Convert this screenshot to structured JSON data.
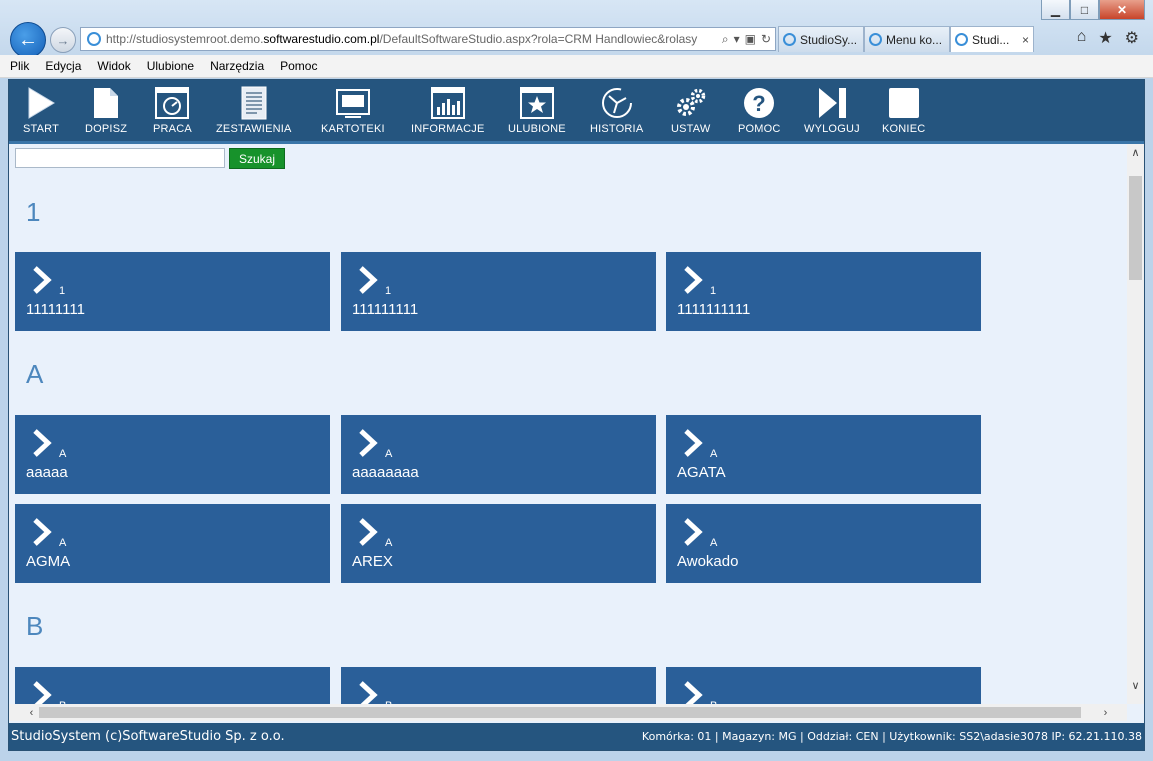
{
  "browser": {
    "url_pre": "http://studiosystemroot.demo.",
    "url_domain": "softwarestudio.com.pl",
    "url_post": "/DefaultSoftwareStudio.aspx?rola=CRM Handlowiec&rolasy",
    "tabs": [
      {
        "label": "StudioSy..."
      },
      {
        "label": "Menu ko..."
      },
      {
        "label": "Studi...",
        "close": "×"
      }
    ],
    "win_buttons": {
      "minimize": "▁",
      "maximize": "□",
      "close": "✕"
    }
  },
  "menu": [
    "Plik",
    "Edycja",
    "Widok",
    "Ulubione",
    "Narzędzia",
    "Pomoc"
  ],
  "toolbar": {
    "items": [
      {
        "label": "START",
        "icon": "play-icon"
      },
      {
        "label": "DOPISZ",
        "icon": "document-icon"
      },
      {
        "label": "PRACA",
        "icon": "gauge-window-icon"
      },
      {
        "label": "ZESTAWIENIA",
        "icon": "report-icon"
      },
      {
        "label": "KARTOTEKI",
        "icon": "monitor-icon"
      },
      {
        "label": "INFORMACJE",
        "icon": "bar-chart-icon"
      },
      {
        "label": "ULUBIONE",
        "icon": "star-window-icon"
      },
      {
        "label": "HISTORIA",
        "icon": "history-icon"
      },
      {
        "label": "USTAW",
        "icon": "gears-icon"
      },
      {
        "label": "POMOC",
        "icon": "help-icon"
      },
      {
        "label": "WYLOGUJ",
        "icon": "skip-icon"
      },
      {
        "label": "KONIEC",
        "icon": "square-icon"
      }
    ]
  },
  "search": {
    "button": "Szukaj",
    "value": ""
  },
  "groups": [
    {
      "head": "1",
      "tiles": [
        {
          "letter": "1",
          "name": "11111111"
        },
        {
          "letter": "1",
          "name": "111111111"
        },
        {
          "letter": "1",
          "name": "1111111111"
        }
      ]
    },
    {
      "head": "A",
      "tiles": [
        {
          "letter": "A",
          "name": "aaaaa"
        },
        {
          "letter": "A",
          "name": "aaaaaaaa"
        },
        {
          "letter": "A",
          "name": "AGATA"
        },
        {
          "letter": "A",
          "name": "AGMA"
        },
        {
          "letter": "A",
          "name": "AREX"
        },
        {
          "letter": "A",
          "name": "Awokado"
        }
      ]
    },
    {
      "head": "B",
      "tiles": [
        {
          "letter": "B",
          "name": ""
        },
        {
          "letter": "B",
          "name": ""
        },
        {
          "letter": "B",
          "name": ""
        }
      ]
    }
  ],
  "status": {
    "left": "StudioSystem (c)SoftwareStudio Sp. z o.o.",
    "right": "Komórka: 01 | Magazyn: MG | Oddział: CEN | Użytkownik: SS2\\adasie3078 IP: 62.21.110.38"
  },
  "colors": {
    "toolbar": "#25557f",
    "tile": "#2a5f99",
    "content_bg": "#e9f1fb",
    "search_button": "#17922b",
    "group_head": "#4d87bd"
  }
}
